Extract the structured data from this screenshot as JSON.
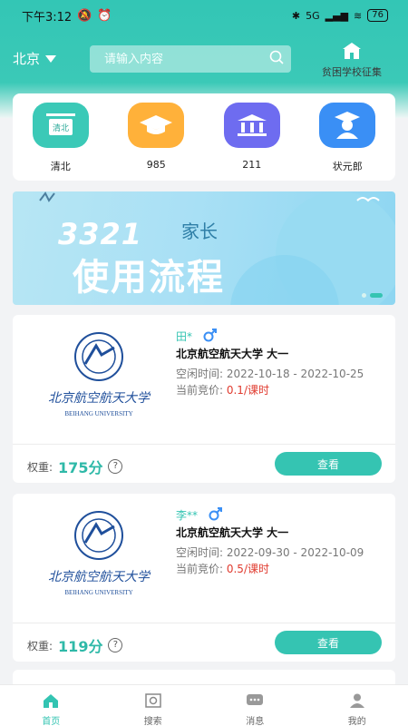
{
  "status": {
    "time": "下午3:12",
    "signal": "5G",
    "battery": "76"
  },
  "header": {
    "city": "北京",
    "search_placeholder": "请输入内容",
    "campaign_label": "贫困学校征集"
  },
  "categories": [
    {
      "label": "清北",
      "icon_text": "清北",
      "color": "#3bc9b7"
    },
    {
      "label": "985",
      "icon_text": "",
      "color": "#ffb13a"
    },
    {
      "label": "211",
      "icon_text": "",
      "color": "#6e6cf0"
    },
    {
      "label": "状元郎",
      "icon_text": "",
      "color": "#3a8ff5"
    }
  ],
  "banner": {
    "line1": "3321",
    "line2": "家长",
    "line3": "使用流程"
  },
  "cards": [
    {
      "name": "田*",
      "school": "北京航空航天大学  大一",
      "free_label": "空闲时间: ",
      "free_time": "2022-10-18 - 2022-10-25",
      "bid_label": "当前竞价: ",
      "bid_value": "0.1/课时",
      "weight_label": "权重:",
      "weight_value": "175分",
      "button": "查看",
      "logo_cn": "北京航空航天大学",
      "logo_en": "BEIHANG UNIVERSITY"
    },
    {
      "name": "李**",
      "school": "北京航空航天大学  大一",
      "free_label": "空闲时间: ",
      "free_time": "2022-09-30 - 2022-10-09",
      "bid_label": "当前竞价: ",
      "bid_value": "0.5/课时",
      "weight_label": "权重:",
      "weight_value": "119分",
      "button": "查看",
      "logo_cn": "北京航空航天大学",
      "logo_en": "BEIHANG UNIVERSITY"
    }
  ],
  "nav": [
    {
      "label": "首页",
      "icon": "home-icon"
    },
    {
      "label": "搜索",
      "icon": "scan-icon"
    },
    {
      "label": "消息",
      "icon": "message-icon"
    },
    {
      "label": "我的",
      "icon": "user-icon"
    }
  ]
}
